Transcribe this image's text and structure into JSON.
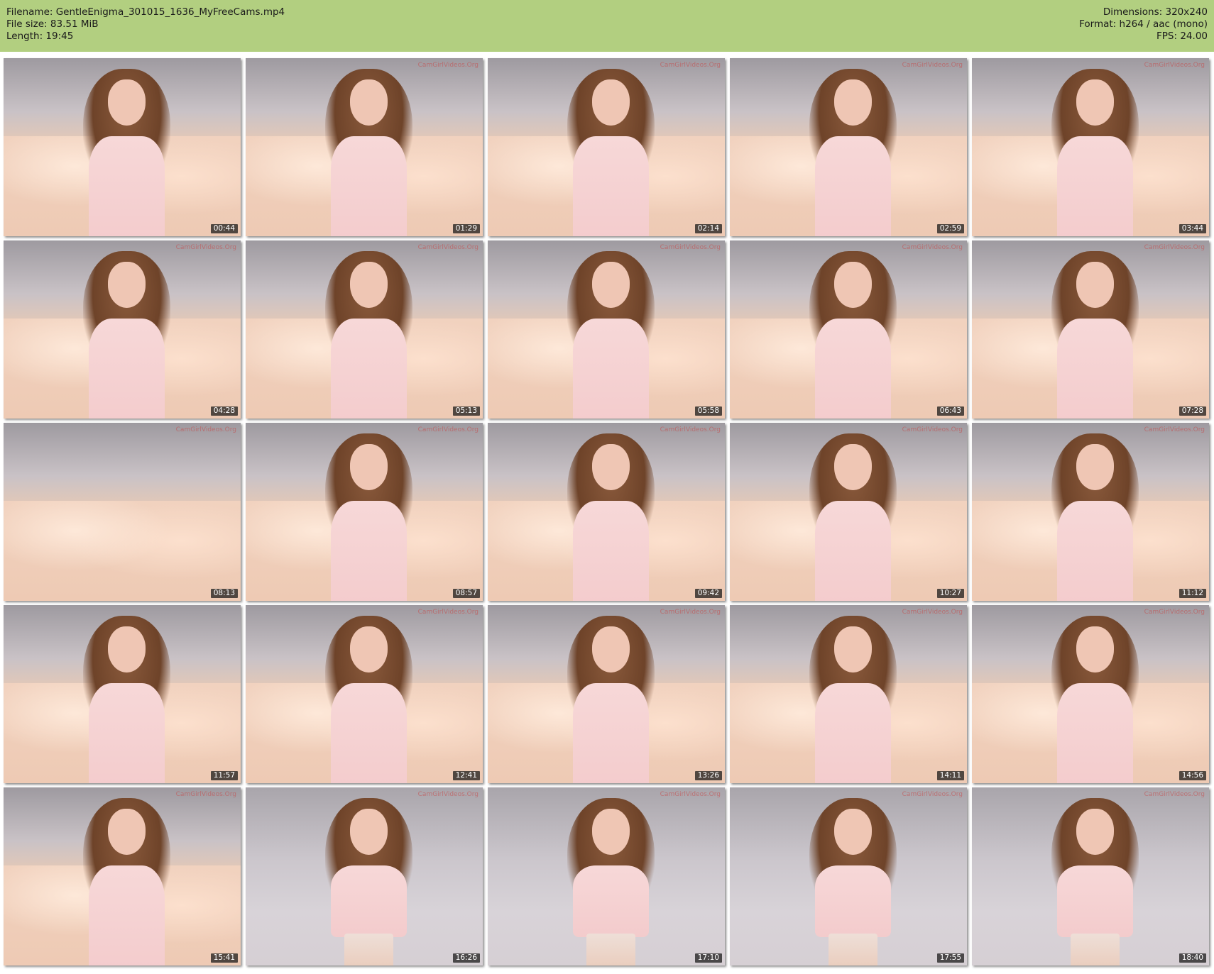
{
  "header": {
    "filename": "Filename: GentleEnigma_301015_1636_MyFreeCams.mp4",
    "filesize": "File size: 83.51 MiB",
    "length": "Length: 19:45",
    "dimensions": "Dimensions: 320x240",
    "format": "Format: h264 / aac (mono)",
    "fps": "FPS: 24.00"
  },
  "watermark": "CamGirlVideos.Org",
  "frames": [
    {
      "time": "00:44",
      "watermark": false,
      "scene": "sofa"
    },
    {
      "time": "01:29",
      "watermark": true,
      "scene": "sofa"
    },
    {
      "time": "02:14",
      "watermark": true,
      "scene": "sofa"
    },
    {
      "time": "02:59",
      "watermark": true,
      "scene": "sofa"
    },
    {
      "time": "03:44",
      "watermark": true,
      "scene": "sofa"
    },
    {
      "time": "04:28",
      "watermark": true,
      "scene": "sofa"
    },
    {
      "time": "05:13",
      "watermark": true,
      "scene": "sofa"
    },
    {
      "time": "05:58",
      "watermark": true,
      "scene": "sofa"
    },
    {
      "time": "06:43",
      "watermark": true,
      "scene": "sofa"
    },
    {
      "time": "07:28",
      "watermark": true,
      "scene": "sofa"
    },
    {
      "time": "08:13",
      "watermark": true,
      "scene": "empty"
    },
    {
      "time": "08:57",
      "watermark": true,
      "scene": "sofa"
    },
    {
      "time": "09:42",
      "watermark": true,
      "scene": "sofa"
    },
    {
      "time": "10:27",
      "watermark": true,
      "scene": "sofa"
    },
    {
      "time": "11:12",
      "watermark": true,
      "scene": "sofa"
    },
    {
      "time": "11:57",
      "watermark": false,
      "scene": "sofa"
    },
    {
      "time": "12:41",
      "watermark": true,
      "scene": "sofa"
    },
    {
      "time": "13:26",
      "watermark": true,
      "scene": "sofa"
    },
    {
      "time": "14:11",
      "watermark": true,
      "scene": "sofa"
    },
    {
      "time": "14:56",
      "watermark": true,
      "scene": "sofa"
    },
    {
      "time": "15:41",
      "watermark": true,
      "scene": "sofa"
    },
    {
      "time": "16:26",
      "watermark": true,
      "scene": "wall"
    },
    {
      "time": "17:10",
      "watermark": true,
      "scene": "wall"
    },
    {
      "time": "17:55",
      "watermark": true,
      "scene": "wall"
    },
    {
      "time": "18:40",
      "watermark": true,
      "scene": "wall"
    }
  ]
}
